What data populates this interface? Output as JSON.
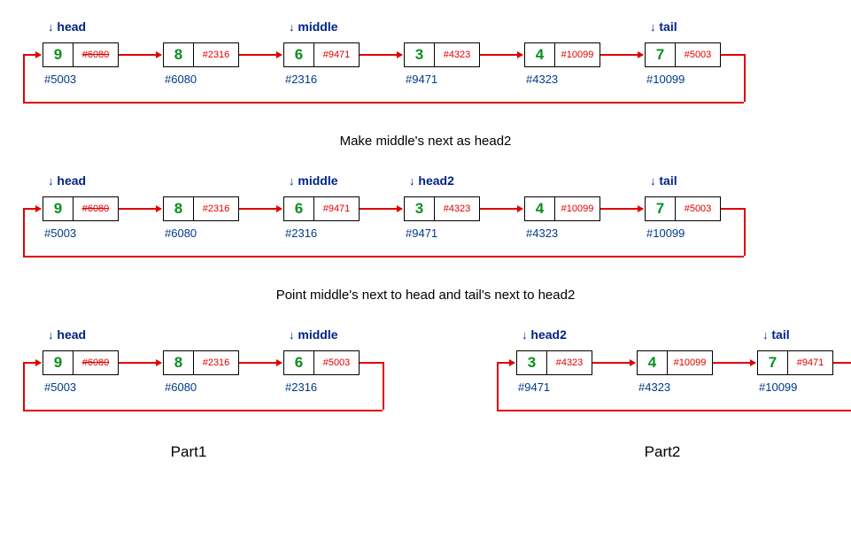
{
  "stage1": {
    "caption": "Make middle's next as head2",
    "nodes": [
      {
        "val": "9",
        "next": "#6080",
        "nextStrike": true,
        "addr": "#5003",
        "ptr": "head"
      },
      {
        "val": "8",
        "next": "#2316",
        "nextStrike": false,
        "addr": "#6080",
        "ptr": ""
      },
      {
        "val": "6",
        "next": "#9471",
        "nextStrike": false,
        "addr": "#2316",
        "ptr": "middle"
      },
      {
        "val": "3",
        "next": "#4323",
        "nextStrike": false,
        "addr": "#9471",
        "ptr": ""
      },
      {
        "val": "4",
        "next": "#10099",
        "nextStrike": false,
        "addr": "#4323",
        "ptr": ""
      },
      {
        "val": "7",
        "next": "#5003",
        "nextStrike": false,
        "addr": "#10099",
        "ptr": "tail"
      }
    ]
  },
  "stage2": {
    "caption": "Point middle's next to head and tail's next to head2",
    "nodes": [
      {
        "val": "9",
        "next": "#6080",
        "nextStrike": true,
        "addr": "#5003",
        "ptr": "head"
      },
      {
        "val": "8",
        "next": "#2316",
        "nextStrike": false,
        "addr": "#6080",
        "ptr": ""
      },
      {
        "val": "6",
        "next": "#9471",
        "nextStrike": false,
        "addr": "#2316",
        "ptr": "middle"
      },
      {
        "val": "3",
        "next": "#4323",
        "nextStrike": false,
        "addr": "#9471",
        "ptr": "head2"
      },
      {
        "val": "4",
        "next": "#10099",
        "nextStrike": false,
        "addr": "#4323",
        "ptr": ""
      },
      {
        "val": "7",
        "next": "#5003",
        "nextStrike": false,
        "addr": "#10099",
        "ptr": "tail"
      }
    ]
  },
  "part1": {
    "label": "Part1",
    "nodes": [
      {
        "val": "9",
        "next": "#6080",
        "nextStrike": true,
        "addr": "#5003",
        "ptr": "head"
      },
      {
        "val": "8",
        "next": "#2316",
        "nextStrike": false,
        "addr": "#6080",
        "ptr": ""
      },
      {
        "val": "6",
        "next": "#5003",
        "nextStrike": false,
        "addr": "#2316",
        "ptr": "middle"
      }
    ]
  },
  "part2": {
    "label": "Part2",
    "nodes": [
      {
        "val": "3",
        "next": "#4323",
        "nextStrike": false,
        "addr": "#9471",
        "ptr": "head2"
      },
      {
        "val": "4",
        "next": "#10099",
        "nextStrike": false,
        "addr": "#4323",
        "ptr": ""
      },
      {
        "val": "7",
        "next": "#9471",
        "nextStrike": false,
        "addr": "#10099",
        "ptr": "tail"
      }
    ]
  }
}
